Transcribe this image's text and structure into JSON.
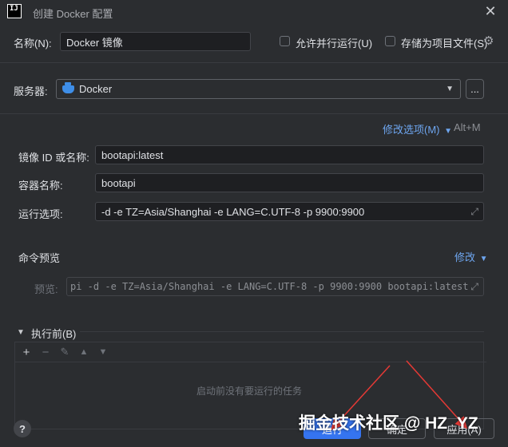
{
  "window": {
    "title": "创建 Docker 配置"
  },
  "form": {
    "name_label": "名称(N):",
    "name_value": "Docker 镜像",
    "allow_parallel_label": "允许并行运行(U)",
    "store_as_file_label": "存储为项目文件(S)"
  },
  "server": {
    "label": "服务器:",
    "value": "Docker",
    "browse_label": "..."
  },
  "modify_options": {
    "label": "修改选项(M)",
    "shortcut": "Alt+M"
  },
  "image": {
    "label": "镜像 ID 或名称:",
    "value": "bootapi:latest"
  },
  "container": {
    "label": "容器名称:",
    "value": "bootapi"
  },
  "run_options": {
    "label": "运行选项:",
    "value": "-d -e TZ=Asia/Shanghai -e LANG=C.UTF-8 -p 9900:9900"
  },
  "command_preview": {
    "section_label": "命令预览",
    "modify_label": "修改",
    "preview_label": "预览:",
    "preview_value": "pi -d -e TZ=Asia/Shanghai -e LANG=C.UTF-8 -p 9900:9900 bootapi:latest"
  },
  "before_launch": {
    "label": "执行前(B)",
    "empty_text": "启动前没有要运行的任务",
    "toolbar": {
      "add": "+",
      "remove": "−",
      "edit": "✎",
      "up": "▲",
      "down": "▼"
    }
  },
  "footer": {
    "help": "?",
    "run_button": "运行",
    "ok_button": "确定",
    "apply_button": "应用(A)"
  },
  "watermark": "掘金技术社区 @ HZ_YZ",
  "colors": {
    "background": "#2b2d30",
    "input_bg": "#1e1f22",
    "link": "#6ea6f0",
    "primary": "#3574f0",
    "arrow": "#e53935"
  }
}
